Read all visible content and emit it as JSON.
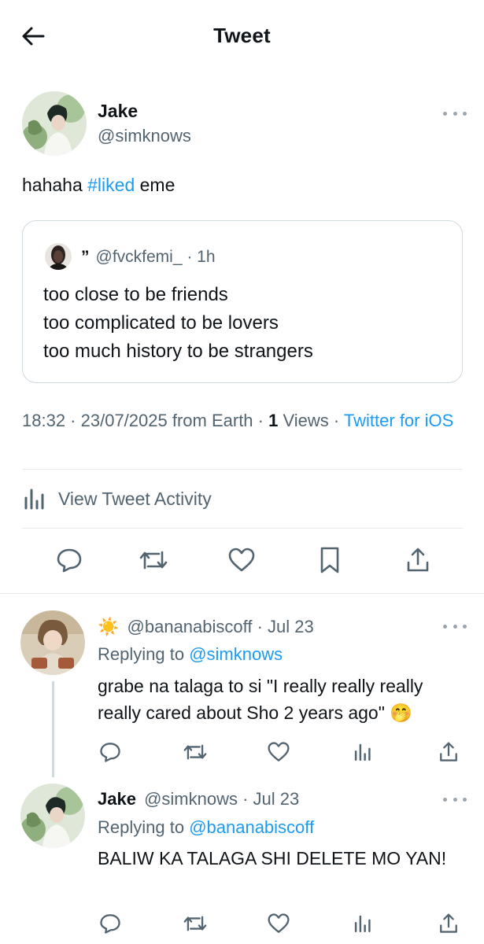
{
  "header": {
    "title": "Tweet",
    "back_icon": "arrow-left-icon"
  },
  "tweet": {
    "author_name": "Jake",
    "author_handle": "@simknows",
    "text_prefix": "hahaha ",
    "hashtag": "#liked",
    "text_suffix": " eme",
    "quote": {
      "name": "”",
      "handle": "@fvckfemi_",
      "time": " · 1h",
      "lines": [
        "too close to be friends",
        "too complicated to be lovers",
        "too much history to be strangers"
      ]
    },
    "meta": {
      "time": "18:32",
      "sep1": " · ",
      "date": "23/07/2025",
      "location": " from Earth",
      "sep2": " · ",
      "views_count": "1",
      "views_label": " Views",
      "sep3": " · ",
      "source": "Twitter for iOS"
    },
    "activity_label": "View Tweet Activity"
  },
  "replies": [
    {
      "name_emoji": "☀️",
      "handle": "@bananabiscoff",
      "time": " · Jul 23",
      "replying_label": "Replying to ",
      "replying_to": "@simknows",
      "text": "grabe na talaga to si \"I really really really really cared about Sho 2 years ago\" 🤭"
    },
    {
      "name": "Jake",
      "handle": "@simknows",
      "time": " · Jul 23",
      "replying_label": "Replying to ",
      "replying_to": "@bananabiscoff",
      "text": "BALIW KA TALAGA SHI DELETE MO YAN!"
    }
  ],
  "colors": {
    "accent": "#1d9bf0",
    "text": "#0f1419",
    "secondary": "#536471",
    "border": "#cfd9de"
  }
}
